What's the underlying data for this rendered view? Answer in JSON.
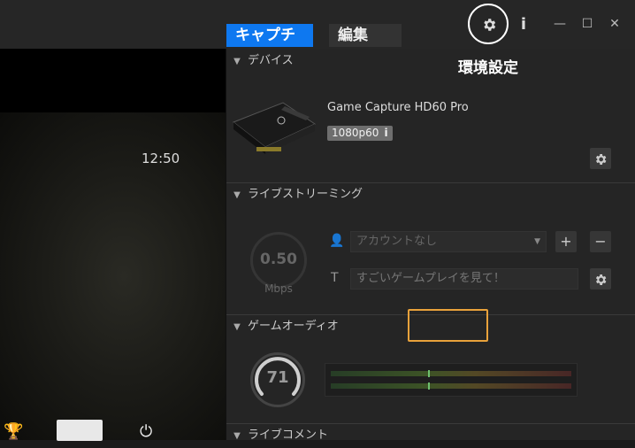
{
  "tabs": [
    {
      "label": "キャプチャ",
      "active": true
    },
    {
      "label": "編集",
      "active": false
    }
  ],
  "toolbar": {
    "settings_icon": "gear-icon",
    "info_label": "i",
    "minimize_label": "—",
    "maximize_label": "☐",
    "close_label": "✕"
  },
  "annotation": {
    "settings_label": "環境設定"
  },
  "preview": {
    "clock": "12:50"
  },
  "sections": {
    "device": {
      "header": "デバイス",
      "name": "Game Capture HD60 Pro",
      "badge": "1080p60",
      "badge_info": "i"
    },
    "streaming": {
      "header": "ライブストリーミング",
      "bitrate_value": "0.50",
      "bitrate_unit": "Mbps",
      "account_placeholder": "アカウントなし",
      "add_label": "+",
      "remove_label": "−",
      "title_prefix": "T",
      "title_value": "すごいゲームプレイを見て！"
    },
    "audio": {
      "header": "ゲームオーディオ",
      "volume": "71",
      "meter_level": 0.41
    },
    "comments": {
      "header": "ライブコメント"
    }
  },
  "colors": {
    "accent": "#0e78f0",
    "highlight": "#e9a23b"
  }
}
